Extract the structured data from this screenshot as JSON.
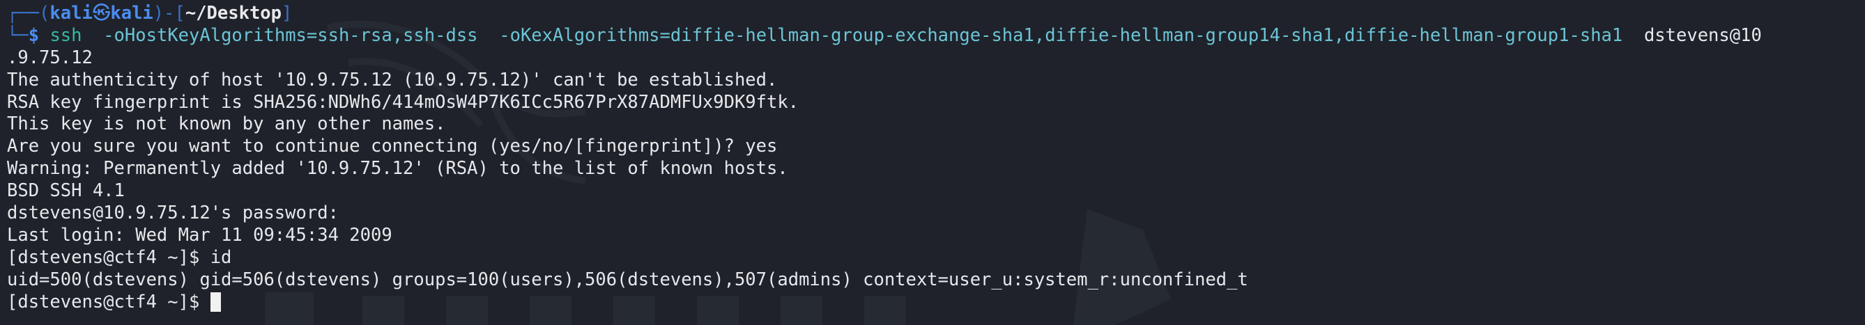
{
  "prompt": {
    "frame_open": "┌──(",
    "user": "kali",
    "at_symbol": "㉿",
    "host": "kali",
    "frame_mid": ")-[",
    "cwd": "~/Desktop",
    "frame_close": "]",
    "frame_bottom": "└─",
    "dollar": "$"
  },
  "command": {
    "name": "ssh",
    "args": "  -oHostKeyAlgorithms=ssh-rsa,ssh-dss  -oKexAlgorithms=diffie-hellman-group-exchange-sha1,diffie-hellman-group14-sha1,diffie-hellman-group1-sha1  ",
    "target": "dstevens@10"
  },
  "output": [
    ".9.75.12",
    "The authenticity of host '10.9.75.12 (10.9.75.12)' can't be established.",
    "RSA key fingerprint is SHA256:NDWh6/414mOsW4P7K6ICc5R67PrX87ADMFUx9DK9ftk.",
    "This key is not known by any other names.",
    "Are you sure you want to continue connecting (yes/no/[fingerprint])? yes",
    "Warning: Permanently added '10.9.75.12' (RSA) to the list of known hosts.",
    "BSD SSH 4.1",
    "dstevens@10.9.75.12's password: ",
    "Last login: Wed Mar 11 09:45:34 2009",
    "[dstevens@ctf4 ~]$ id",
    "uid=500(dstevens) gid=506(dstevens) groups=100(users),506(dstevens),507(admins) context=user_u:system_r:unconfined_t"
  ],
  "remote_prompt": "[dstevens@ctf4 ~]$ ",
  "colors": {
    "background": "#1f222a",
    "text": "#e6e8ec",
    "prompt_blue": "#4b8cf0",
    "command_teal": "#36b8a4",
    "argument_cyan": "#6bc4d6"
  }
}
